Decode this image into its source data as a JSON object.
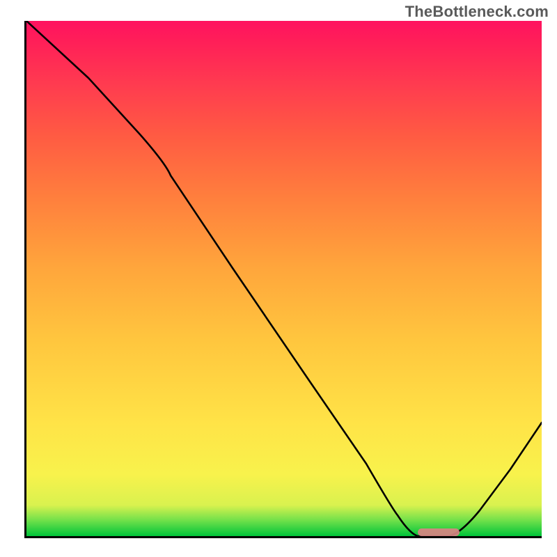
{
  "watermark": "TheBottleneck.com",
  "chart_data": {
    "type": "line",
    "title": "",
    "xlabel": "",
    "ylabel": "",
    "xlim": [
      0,
      100
    ],
    "ylim": [
      0,
      100
    ],
    "grid": false,
    "legend_position": "none",
    "series": [
      {
        "name": "bottleneck-curve",
        "x": [
          0,
          12,
          22,
          28,
          40,
          55,
          66,
          72,
          76,
          82,
          88,
          94,
          100
        ],
        "values": [
          100,
          89,
          78,
          70,
          52,
          30,
          14,
          4,
          0,
          0,
          5,
          13,
          22
        ]
      }
    ],
    "annotations": [
      {
        "name": "optimal-marker",
        "x_start": 76,
        "x_end": 84,
        "y": 0,
        "color": "#d98383"
      }
    ],
    "background": {
      "type": "vertical-gradient",
      "stops": [
        {
          "pos": 0,
          "color": "#00c43a"
        },
        {
          "pos": 12,
          "color": "#f8f24c"
        },
        {
          "pos": 50,
          "color": "#ffa63c"
        },
        {
          "pos": 100,
          "color": "#ff1260"
        }
      ]
    }
  }
}
